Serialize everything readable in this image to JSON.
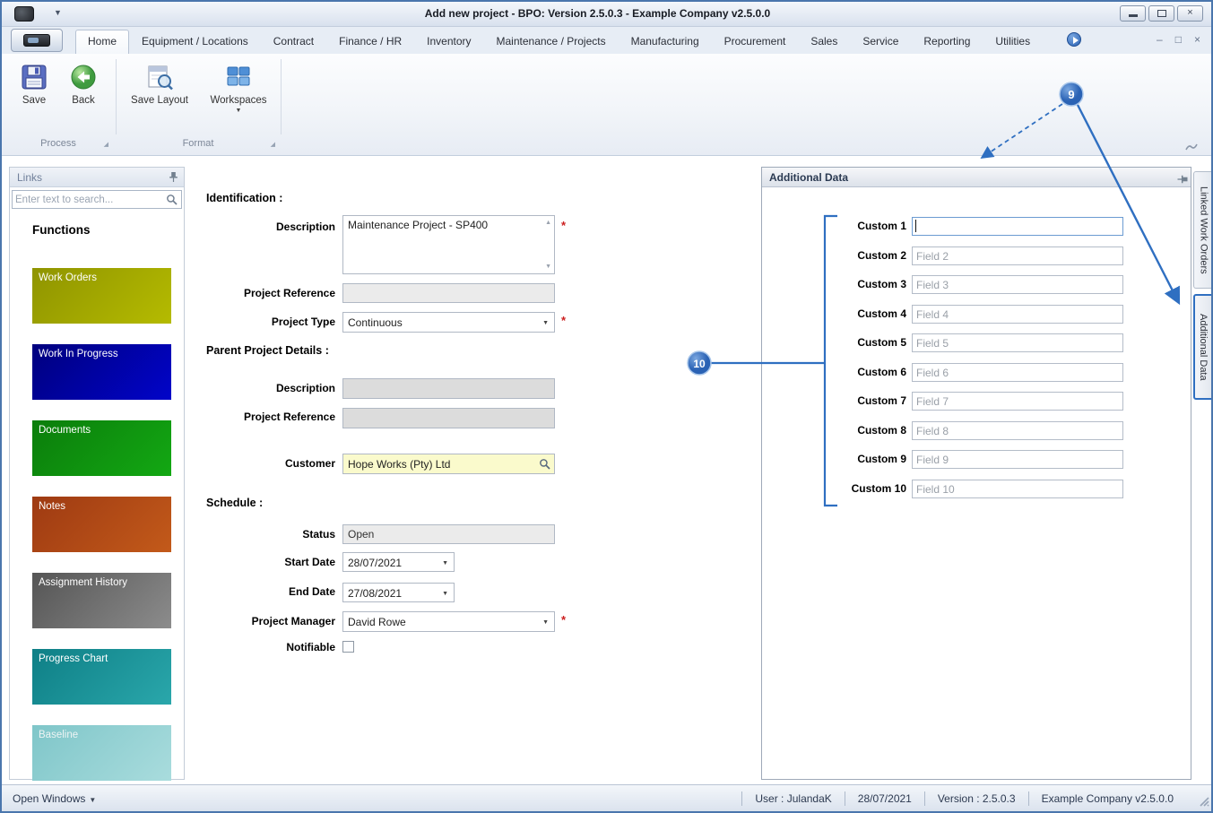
{
  "titlebar": {
    "title": "Add new project - BPO: Version 2.5.0.3 - Example Company v2.5.0.0"
  },
  "ribbon": {
    "tabs": [
      "Home",
      "Equipment / Locations",
      "Contract",
      "Finance / HR",
      "Inventory",
      "Maintenance / Projects",
      "Manufacturing",
      "Procurement",
      "Sales",
      "Service",
      "Reporting",
      "Utilities"
    ],
    "active_tab": "Home",
    "buttons": {
      "save": "Save",
      "back": "Back",
      "save_layout": "Save Layout",
      "workspaces": "Workspaces"
    },
    "groups": {
      "process": "Process",
      "format": "Format"
    }
  },
  "links_panel": {
    "title": "Links",
    "search_placeholder": "Enter text to search...",
    "heading": "Functions",
    "tiles": [
      {
        "label": "Work Orders",
        "colors": [
          "#8f9400",
          "#b5bb00"
        ]
      },
      {
        "label": "Work In Progress",
        "colors": [
          "#00007e",
          "#0104c9"
        ]
      },
      {
        "label": "Documents",
        "colors": [
          "#0b7d0b",
          "#13a813"
        ]
      },
      {
        "label": "Notes",
        "colors": [
          "#9e3a12",
          "#c35a1a"
        ]
      },
      {
        "label": "Assignment History",
        "colors": [
          "#555555",
          "#8c8c8c"
        ]
      },
      {
        "label": "Progress Chart",
        "colors": [
          "#0e7f86",
          "#2aa7ab"
        ]
      },
      {
        "label": "Baseline",
        "colors": [
          "#7fc6c9",
          "#a9dcdd"
        ]
      }
    ]
  },
  "form": {
    "required_marker": "*",
    "sections": {
      "identification": "Identification :",
      "parent": "Parent Project Details :",
      "schedule": "Schedule :"
    },
    "description": {
      "label": "Description",
      "value": "Maintenance Project - SP400",
      "required": true
    },
    "project_reference": {
      "label": "Project Reference",
      "value": ""
    },
    "project_type": {
      "label": "Project Type",
      "value": "Continuous",
      "required": true
    },
    "parent_description": {
      "label": "Description",
      "value": ""
    },
    "parent_reference": {
      "label": "Project Reference",
      "value": ""
    },
    "customer": {
      "label": "Customer",
      "value": "Hope Works (Pty) Ltd"
    },
    "status": {
      "label": "Status",
      "value": "Open"
    },
    "start_date": {
      "label": "Start Date",
      "value": "28/07/2021"
    },
    "end_date": {
      "label": "End Date",
      "value": "27/08/2021"
    },
    "project_manager": {
      "label": "Project Manager",
      "value": "David Rowe",
      "required": true
    },
    "notifiable": {
      "label": "Notifiable",
      "checked": false
    }
  },
  "additional_data": {
    "title": "Additional Data",
    "fields": [
      {
        "label": "Custom 1",
        "placeholder": "",
        "focused": true
      },
      {
        "label": "Custom 2",
        "placeholder": "Field 2"
      },
      {
        "label": "Custom 3",
        "placeholder": "Field 3"
      },
      {
        "label": "Custom 4",
        "placeholder": "Field 4"
      },
      {
        "label": "Custom 5",
        "placeholder": "Field 5"
      },
      {
        "label": "Custom 6",
        "placeholder": "Field 6"
      },
      {
        "label": "Custom 7",
        "placeholder": "Field 7"
      },
      {
        "label": "Custom 8",
        "placeholder": "Field 8"
      },
      {
        "label": "Custom 9",
        "placeholder": "Field 9"
      },
      {
        "label": "Custom 10",
        "placeholder": "Field 10"
      }
    ]
  },
  "side_tabs": [
    {
      "label": "Linked Work Orders"
    },
    {
      "label": "Additional Data"
    }
  ],
  "callouts": {
    "nine": "9",
    "ten": "10",
    "accent_color": "#2f6fc1"
  },
  "statusbar": {
    "open_windows": "Open Windows",
    "user": "User : JulandaK",
    "date": "28/07/2021",
    "version": "Version : 2.5.0.3",
    "company": "Example Company v2.5.0.0"
  }
}
